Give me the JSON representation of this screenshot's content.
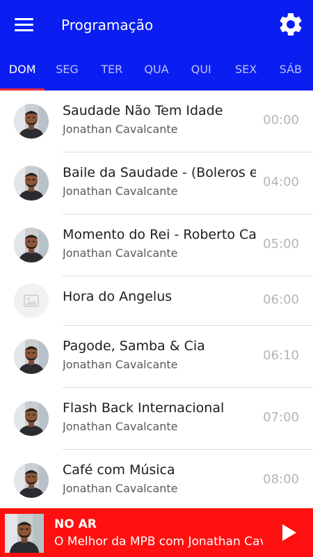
{
  "app_bar": {
    "title": "Programação",
    "menu_icon": "hamburger-menu-icon",
    "settings_icon": "gear-icon",
    "color": "#0a1ef2"
  },
  "tabs": [
    {
      "label": "DOM",
      "active": true
    },
    {
      "label": "SEG",
      "active": false
    },
    {
      "label": "TER",
      "active": false
    },
    {
      "label": "QUA",
      "active": false
    },
    {
      "label": "QUI",
      "active": false
    },
    {
      "label": "SEX",
      "active": false
    },
    {
      "label": "SÁB",
      "active": false
    }
  ],
  "tab_indicator_color": "#e8283a",
  "schedule": [
    {
      "name": "Saudade Não Tem Idade",
      "host": "Jonathan Cavalcante",
      "time": "00:00",
      "avatar": "host-photo"
    },
    {
      "name": "Baile da Saudade - (Boleros e Tangos)",
      "host": "Jonathan Cavalcante",
      "time": "04:00",
      "avatar": "host-photo"
    },
    {
      "name": "Momento do Rei - Roberto Carlos",
      "host": "Jonathan Cavalcante",
      "time": "05:00",
      "avatar": "host-photo"
    },
    {
      "name": "Hora do Angelus",
      "host": "",
      "time": "06:00",
      "avatar": "image-placeholder-icon"
    },
    {
      "name": "Pagode, Samba & Cia",
      "host": "Jonathan Cavalcante",
      "time": "06:10",
      "avatar": "host-photo"
    },
    {
      "name": "Flash Back Internacional",
      "host": "Jonathan Cavalcante",
      "time": "07:00",
      "avatar": "host-photo"
    },
    {
      "name": "Café com Música",
      "host": "Jonathan Cavalcante",
      "time": "08:00",
      "avatar": "host-photo"
    }
  ],
  "now_playing": {
    "label": "NO AR",
    "title": "O Melhor da MPB com Jonathan Cavalcante",
    "play_icon": "play-icon",
    "color": "#ff1010"
  }
}
